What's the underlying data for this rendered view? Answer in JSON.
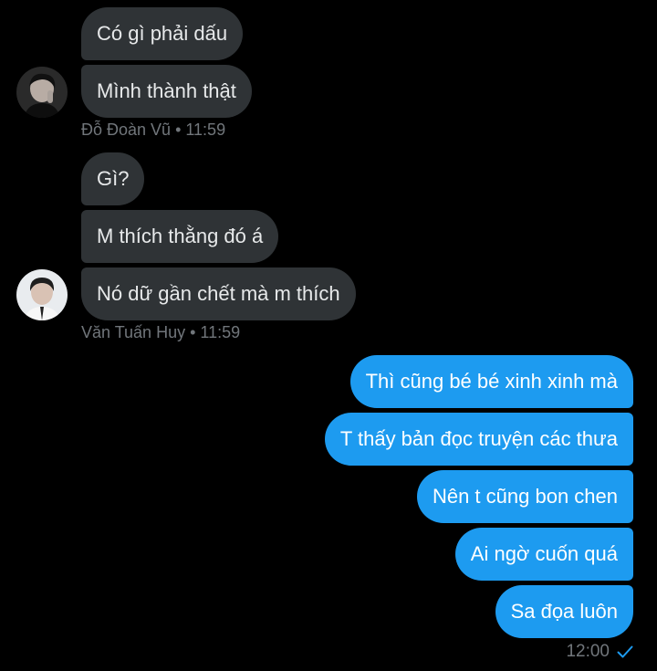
{
  "conversation": {
    "group1": {
      "messages": [
        "Có gì phải dấu",
        "Mình thành thật"
      ],
      "sender": "Đỗ Đoàn Vũ",
      "time": "11:59"
    },
    "group2": {
      "messages": [
        "Gì?",
        "M thích thằng đó á",
        "Nó dữ gần chết mà m thích"
      ],
      "sender": "Văn Tuấn Huy",
      "time": "11:59"
    },
    "outgoing": {
      "messages": [
        "Thì cũng bé bé xinh xinh mà",
        "T thấy bản đọc truyện các thưa",
        "Nên t cũng bon chen",
        "Ai ngờ cuốn quá",
        "Sa đọa luôn"
      ],
      "time": "12:00",
      "status_icon": "check-icon"
    },
    "separator": "•"
  },
  "colors": {
    "background": "#000000",
    "incoming_bubble": "#2f3336",
    "outgoing_bubble": "#1d9bf0",
    "meta_text": "#71767b"
  }
}
